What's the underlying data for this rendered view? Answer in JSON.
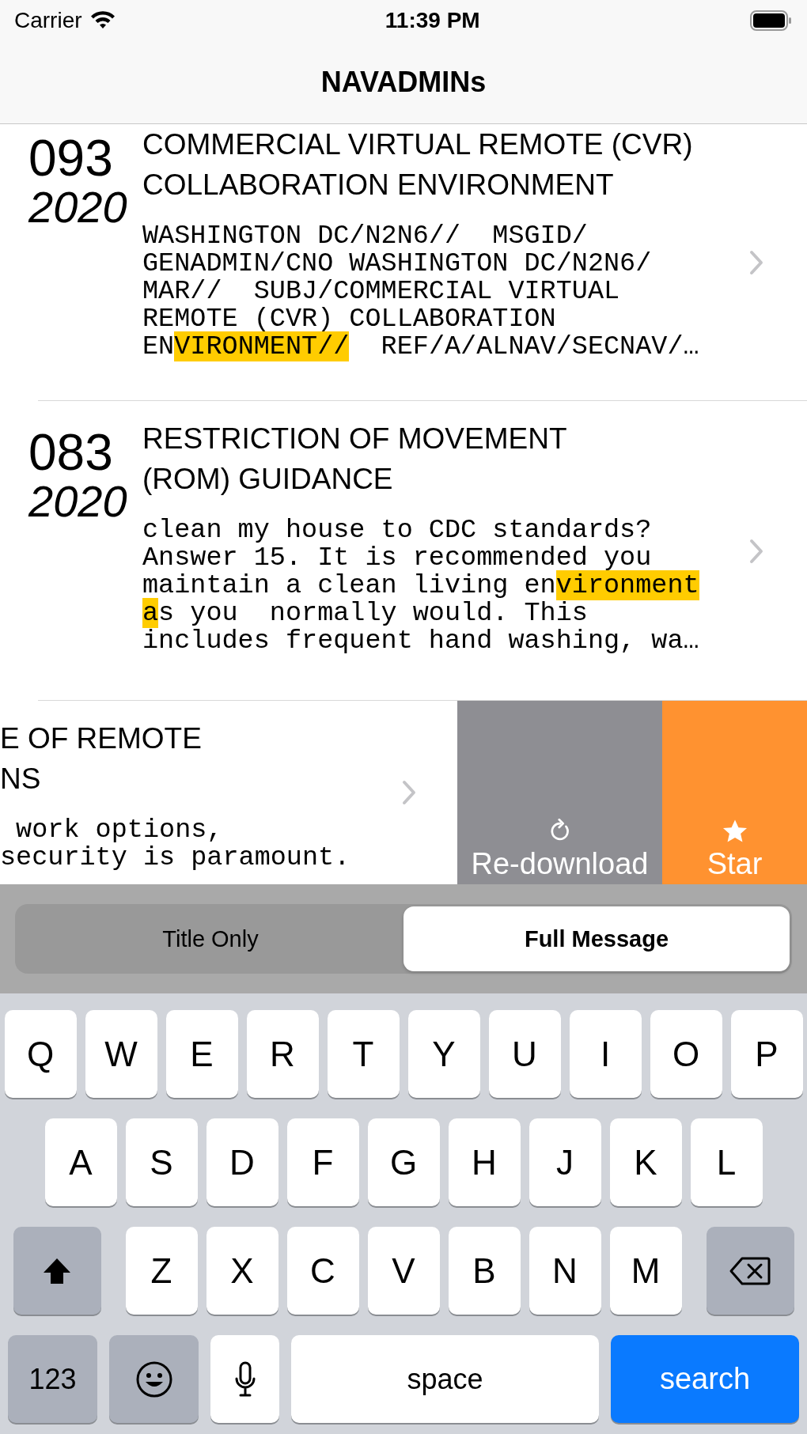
{
  "status_bar": {
    "carrier": "Carrier",
    "time": "11:39 PM"
  },
  "nav_bar": {
    "title": "NAVADMINs"
  },
  "messages": [
    {
      "number": "093",
      "year": "2020",
      "title": "COMMERCIAL VIRTUAL REMOTE (CVR) COLLABORATION ENVIRONMENT",
      "body": [
        {
          "text": "WASHINGTON DC/N2N6//  MSGID/\nGENADMIN/CNO WASHINGTON DC/N2N6/\nMAR//  SUBJ/COMMERCIAL VIRTUAL\nREMOTE (CVR) COLLABORATION\nEN",
          "highlight": false
        },
        {
          "text": "VIRONMENT//",
          "highlight": true
        },
        {
          "text": "  REF/A/ALNAV/SECNAV/…",
          "highlight": false
        }
      ]
    },
    {
      "number": "083",
      "year": "2020",
      "title": "RESTRICTION OF MOVEMENT\n(ROM) GUIDANCE",
      "body": [
        {
          "text": "clean my house to CDC standards?\nAnswer 15. It is recommended you\nmaintain a clean living en",
          "highlight": false
        },
        {
          "text": "vironment\na",
          "highlight": true
        },
        {
          "text": "s you  normally would. This\nincludes frequent hand washing, wa…",
          "highlight": false
        }
      ]
    }
  ],
  "swiped_message": {
    "title": "E OF REMOTE\nNS",
    "body": [
      {
        "text": " work options,\nsecurity is paramount.",
        "highlight": false
      }
    ],
    "actions": [
      {
        "kind": "redownload",
        "label": "Re-download"
      },
      {
        "kind": "star",
        "label": "Star"
      }
    ]
  },
  "search_scope": [
    {
      "label": "Title Only",
      "selected": false
    },
    {
      "label": "Full Message",
      "selected": true
    }
  ],
  "keyboard": {
    "rows": [
      [
        "Q",
        "W",
        "E",
        "R",
        "T",
        "Y",
        "U",
        "I",
        "O",
        "P"
      ],
      [
        "A",
        "S",
        "D",
        "F",
        "G",
        "H",
        "J",
        "K",
        "L"
      ],
      [
        "Z",
        "X",
        "C",
        "V",
        "B",
        "N",
        "M"
      ]
    ],
    "numbers_key": "123",
    "space_key": "space",
    "search_key": "search"
  }
}
